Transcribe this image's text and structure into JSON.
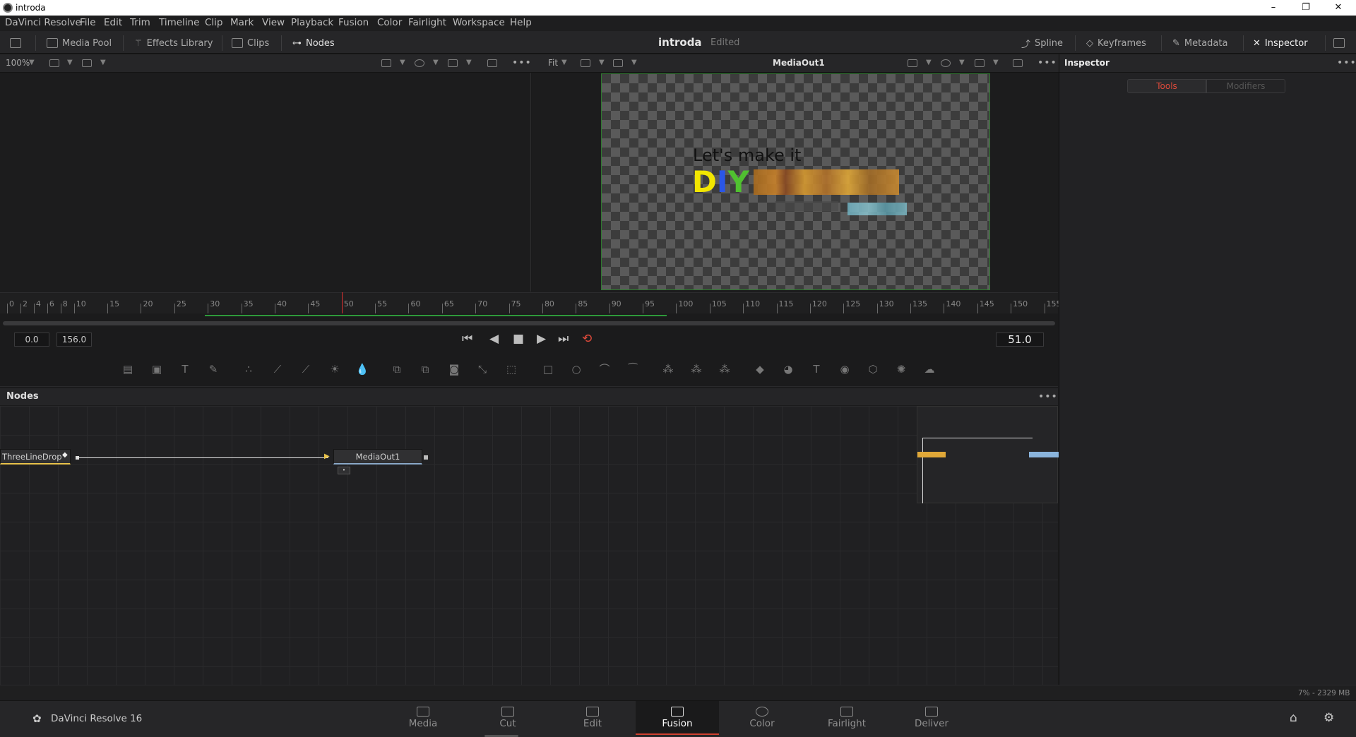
{
  "window": {
    "title": "introda",
    "controls": [
      "–",
      "❐",
      "✕"
    ]
  },
  "menu": [
    "DaVinci Resolve",
    "File",
    "Edit",
    "Trim",
    "Timeline",
    "Clip",
    "Mark",
    "View",
    "Playback",
    "Fusion",
    "Color",
    "Fairlight",
    "Workspace",
    "Help"
  ],
  "toolbar": {
    "media_pool": "Media Pool",
    "effects_library": "Effects Library",
    "clips": "Clips",
    "nodes": "Nodes",
    "project_name": "introda",
    "project_status": "Edited",
    "spline": "Spline",
    "keyframes": "Keyframes",
    "metadata": "Metadata",
    "inspector": "Inspector"
  },
  "viewer": {
    "left_zoom": "100%",
    "right_zoom": "Fit",
    "right_title": "MediaOut1",
    "overlay_line1": "Let's make it",
    "overlay_d": "D",
    "overlay_i": "I",
    "overlay_y": "Y"
  },
  "ruler": {
    "labels": [
      "0",
      "2",
      "4",
      "6",
      "8",
      "10",
      "15",
      "20",
      "25",
      "30",
      "35",
      "40",
      "45",
      "50",
      "55",
      "60",
      "65",
      "70",
      "75",
      "80",
      "85",
      "90",
      "95",
      "100",
      "105",
      "110",
      "115",
      "120",
      "125",
      "130",
      "135",
      "140",
      "145",
      "150",
      "155"
    ],
    "current_frame_marker": 50
  },
  "transport": {
    "start": "0.0",
    "end": "156.0",
    "current": "51.0"
  },
  "nodes": {
    "title": "Nodes",
    "node_left": "ThreeLineDrop",
    "node_right": "MediaOut1"
  },
  "inspector": {
    "title": "Inspector",
    "tab_tools": "Tools",
    "tab_modifiers": "Modifiers"
  },
  "status": {
    "memory": "7% - 2329 MB"
  },
  "pages": {
    "brand": "DaVinci Resolve 16",
    "items": [
      "Media",
      "Cut",
      "Edit",
      "Fusion",
      "Color",
      "Fairlight",
      "Deliver"
    ],
    "active": "Fusion"
  },
  "colors": {
    "accent_red": "#d0402f",
    "active_tab_red": "#e04a3a",
    "node_link": "#e8c24a",
    "canvas_border": "#2f7a2f"
  }
}
